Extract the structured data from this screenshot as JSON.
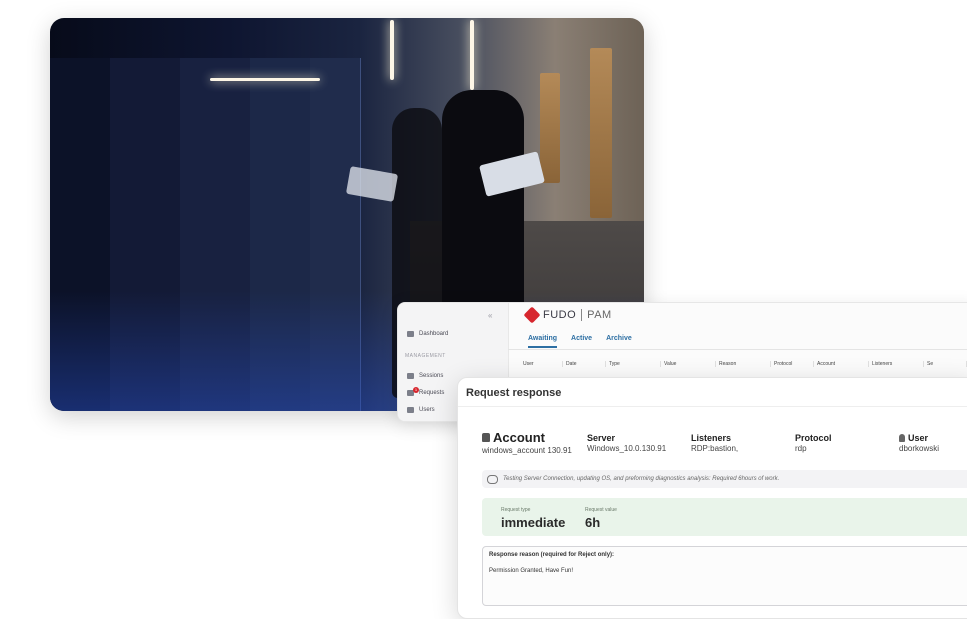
{
  "brand": {
    "name": "FUDO",
    "product": "PAM",
    "accent": "#d7262e"
  },
  "sidebar": {
    "dashboard": "Dashboard",
    "section": "MANAGEMENT",
    "items": [
      {
        "label": "Sessions",
        "icon": "sessions-icon"
      },
      {
        "label": "Requests",
        "icon": "requests-icon",
        "badge": "1"
      },
      {
        "label": "Users",
        "icon": "users-icon"
      }
    ]
  },
  "tabs": [
    {
      "label": "Awaiting",
      "active": true
    },
    {
      "label": "Active",
      "active": false
    },
    {
      "label": "Archive",
      "active": false
    }
  ],
  "columns": [
    "User",
    "Date",
    "Type",
    "Value",
    "Reason",
    "Protocol",
    "Account",
    "Listeners",
    "Se"
  ],
  "modal": {
    "title": "Request response",
    "account": {
      "label": "Account",
      "value": "windows_account 130.91"
    },
    "server": {
      "label": "Server",
      "value": "Windows_10.0.130.91"
    },
    "listeners": {
      "label": "Listeners",
      "value": "RDP:bastion,"
    },
    "protocol": {
      "label": "Protocol",
      "value": "rdp"
    },
    "user": {
      "label": "User",
      "value": "dborkowski"
    },
    "comment": "Testing Server Connection, updating OS, and preforming diagnostics analysis: Required 6hours of work.",
    "request_type": {
      "label": "Request type",
      "value": "immediate"
    },
    "request_value": {
      "label": "Request value",
      "value": "6h"
    },
    "reason": {
      "label": "Response reason (required for Reject only):",
      "value": "Permission Granted, Have Fun!"
    }
  },
  "colors": {
    "tab": "#2d6fa3",
    "request_box": "#e9f4ea"
  }
}
